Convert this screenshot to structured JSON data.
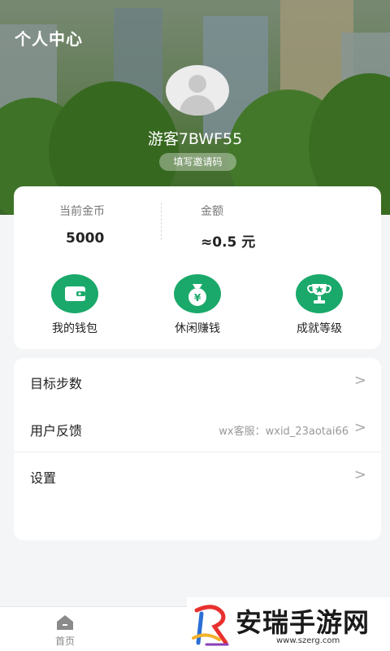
{
  "header": {
    "title": "个人中心"
  },
  "profile": {
    "username": "游客7BWF55",
    "invite_label": "填写邀请码"
  },
  "stats": {
    "coins_label": "当前金币",
    "coins_value": "5000",
    "amount_label": "金额",
    "amount_value": "≈0.5 元"
  },
  "actions": [
    {
      "label": "我的钱包",
      "icon": "wallet-icon"
    },
    {
      "label": "休闲赚钱",
      "icon": "money-bag-icon"
    },
    {
      "label": "成就等级",
      "icon": "trophy-icon"
    }
  ],
  "menu": {
    "items": [
      {
        "label": "目标步数",
        "extra": ""
      },
      {
        "label": "用户反馈",
        "extra": "wx客服：wxid_23aotai66"
      },
      {
        "label": "设置",
        "extra": ""
      }
    ],
    "chevron": ">"
  },
  "tabbar": {
    "home_label": "首页",
    "home_icon": "home-icon"
  },
  "watermark": {
    "title": "安瑞手游网",
    "url": "www.szerg.com"
  },
  "colors": {
    "accent": "#1aa96a",
    "background": "#f4f5f6"
  }
}
